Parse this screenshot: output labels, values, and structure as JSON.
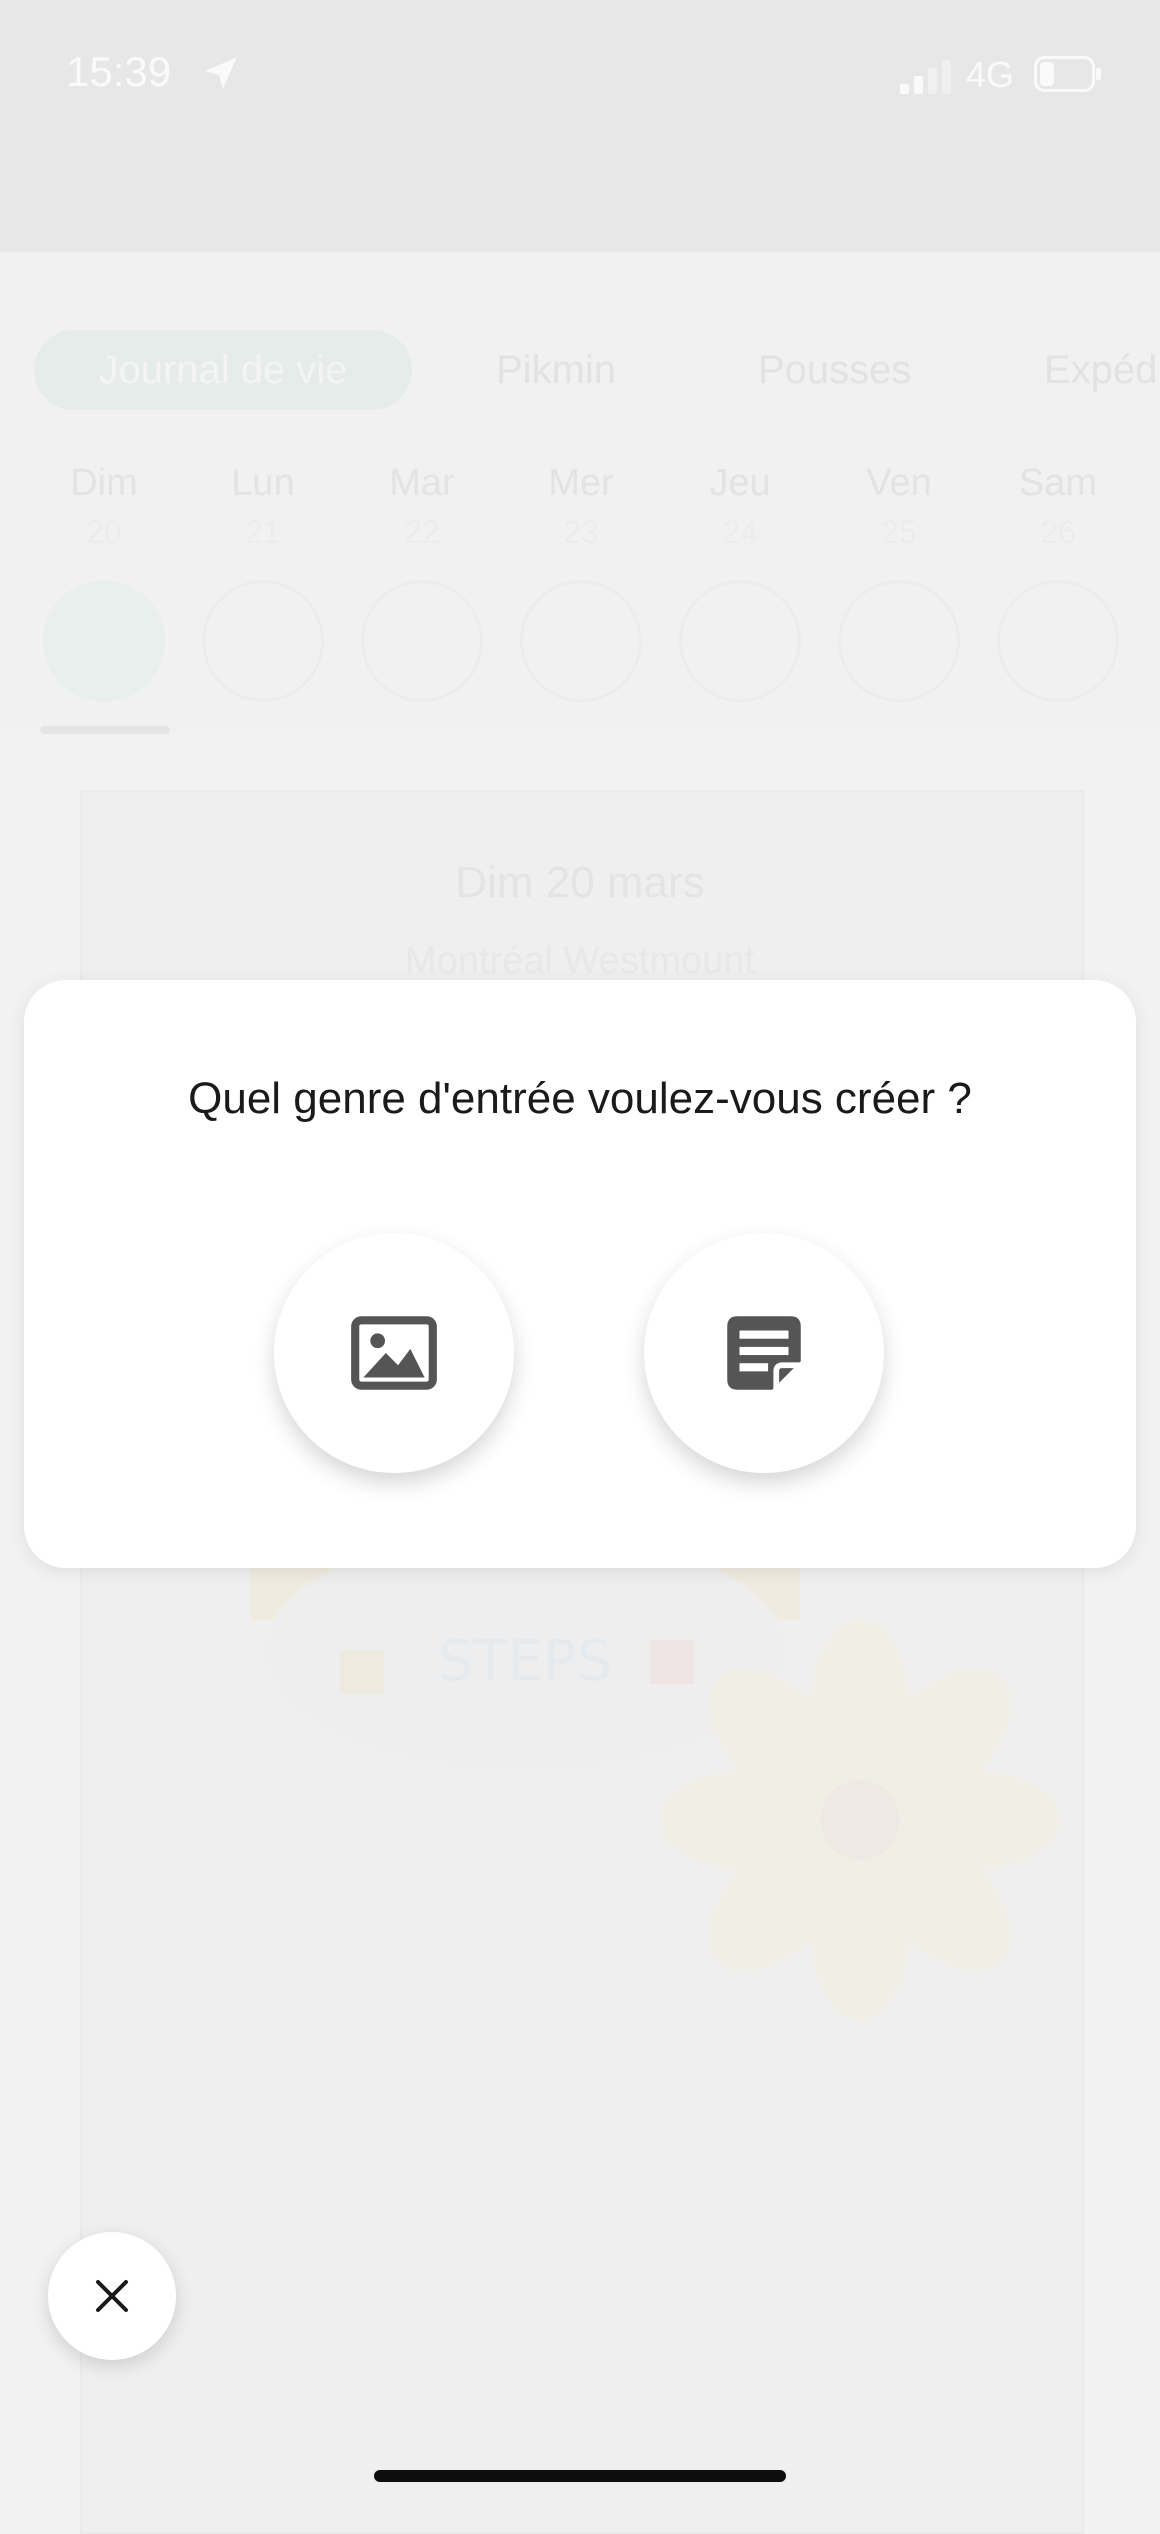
{
  "status_bar": {
    "time": "15:39",
    "network": "4G",
    "icons": [
      "location-arrow-icon",
      "signal-icon",
      "battery-icon"
    ]
  },
  "tabs": [
    {
      "label": "Journal de vie",
      "active": true
    },
    {
      "label": "Pikmin",
      "active": false
    },
    {
      "label": "Pousses",
      "active": false
    },
    {
      "label": "Expéd",
      "active": false
    }
  ],
  "week": [
    {
      "day": "Dim",
      "date": "20",
      "selected": true
    },
    {
      "day": "Lun",
      "date": "21",
      "selected": false
    },
    {
      "day": "Mar",
      "date": "22",
      "selected": false
    },
    {
      "day": "Mer",
      "date": "23",
      "selected": false
    },
    {
      "day": "Jeu",
      "date": "24",
      "selected": false
    },
    {
      "day": "Ven",
      "date": "25",
      "selected": false
    },
    {
      "day": "Sam",
      "date": "26",
      "selected": false
    }
  ],
  "card": {
    "date": "Dim 20 mars",
    "location": "Montréal Westmount",
    "decoration_text": "STEPS"
  },
  "dialog": {
    "title": "Quel genre d'entrée voulez-vous créer ?",
    "options": [
      {
        "icon": "image-icon",
        "action": "photo-entry"
      },
      {
        "icon": "note-icon",
        "action": "text-entry"
      }
    ]
  },
  "fab": {
    "icon": "close-icon"
  },
  "colors": {
    "overlay": "#f2f2f2",
    "dialog": "#ffffff",
    "icon": "#555555",
    "text": "#1a1a1a"
  }
}
